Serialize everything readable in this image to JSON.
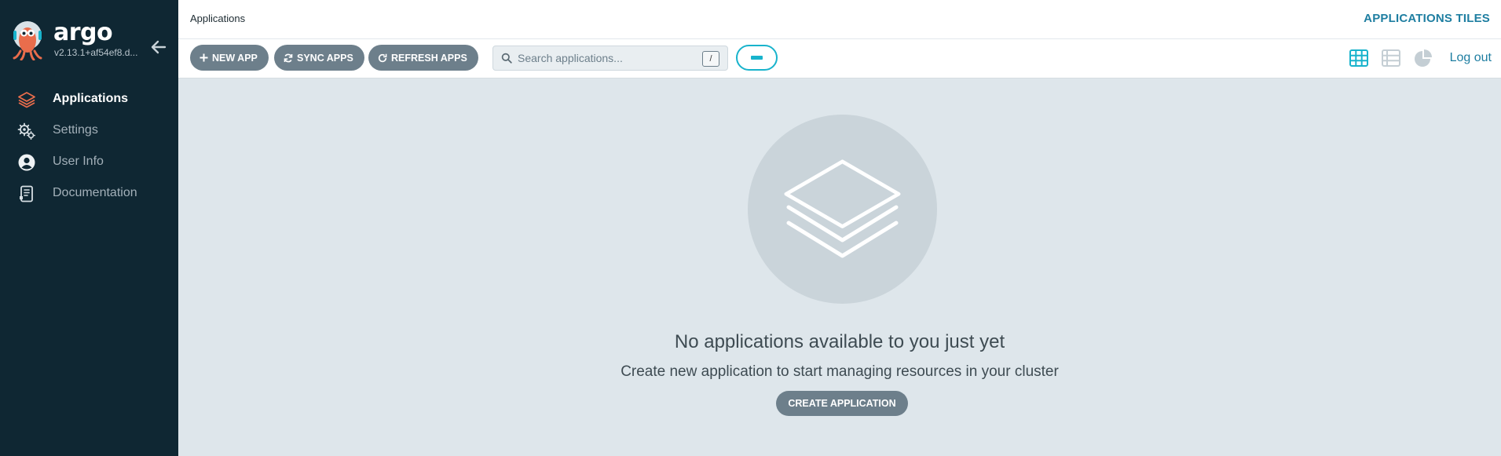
{
  "sidebar": {
    "brand": "argo",
    "version": "v2.13.1+af54ef8.d...",
    "items": [
      {
        "label": "Applications",
        "icon": "layers-icon",
        "active": true
      },
      {
        "label": "Settings",
        "icon": "gears-icon",
        "active": false
      },
      {
        "label": "User Info",
        "icon": "user-circle-icon",
        "active": false
      },
      {
        "label": "Documentation",
        "icon": "book-icon",
        "active": false
      }
    ]
  },
  "header": {
    "breadcrumb": "Applications",
    "page_type": "APPLICATIONS TILES"
  },
  "toolbar": {
    "new_app": "NEW APP",
    "sync_apps": "SYNC APPS",
    "refresh_apps": "REFRESH APPS",
    "search_placeholder": "Search applications...",
    "search_shortcut": "/",
    "logout": "Log out",
    "active_view": "tiles"
  },
  "empty_state": {
    "title": "No applications available to you just yet",
    "subtitle": "Create new application to start managing resources in your cluster",
    "button": "CREATE APPLICATION"
  },
  "colors": {
    "sidebar_bg": "#0f2733",
    "accent": "#18b3cc",
    "link": "#1e7ea1",
    "pill_button": "#6d7f8b",
    "page_bg": "#dee6eb",
    "active_nav_icon": "#e96d4c"
  }
}
